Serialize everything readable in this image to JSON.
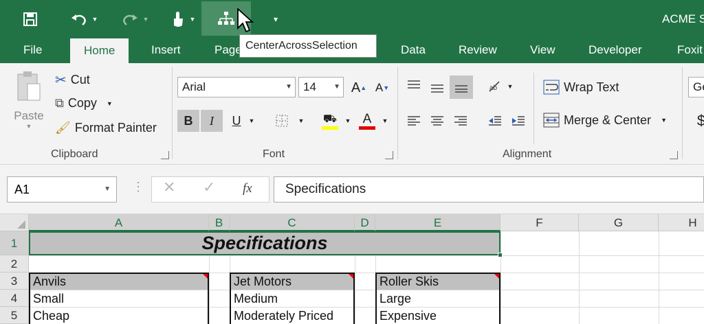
{
  "window": {
    "title": "ACME S"
  },
  "qat": {
    "tooltip": "CenterAcrossSelection"
  },
  "tabs": [
    "File",
    "Home",
    "Insert",
    "Page",
    "Data",
    "Review",
    "View",
    "Developer",
    "Foxit"
  ],
  "clipboard": {
    "paste": "Paste",
    "cut": "Cut",
    "copy": "Copy",
    "format_painter": "Format Painter",
    "label": "Clipboard"
  },
  "font": {
    "name": "Arial",
    "size": "14",
    "label": "Font",
    "bold": "B",
    "italic": "I",
    "underline": "U"
  },
  "alignment": {
    "wrap": "Wrap Text",
    "merge": "Merge & Center",
    "label": "Alignment"
  },
  "number": {
    "format": "Ge",
    "symbol": "$"
  },
  "formula_bar": {
    "namebox": "A1",
    "fx": "fx",
    "value": "Specifications"
  },
  "columns": [
    "A",
    "B",
    "C",
    "D",
    "E",
    "F",
    "G",
    "H"
  ],
  "rows": [
    "1",
    "2",
    "3",
    "4",
    "5"
  ],
  "cells": {
    "a1": "Specifications",
    "a3": "Anvils",
    "a4": "Small",
    "a5": "Cheap",
    "c3": "Jet Motors",
    "c4": "Medium",
    "c5": "Moderately Priced",
    "e3": "Roller Skis",
    "e4": "Large",
    "e5": "Expensive"
  },
  "colors": {
    "brand": "#217346",
    "header_fill": "#c0c0c0",
    "comment": "#e00000"
  }
}
